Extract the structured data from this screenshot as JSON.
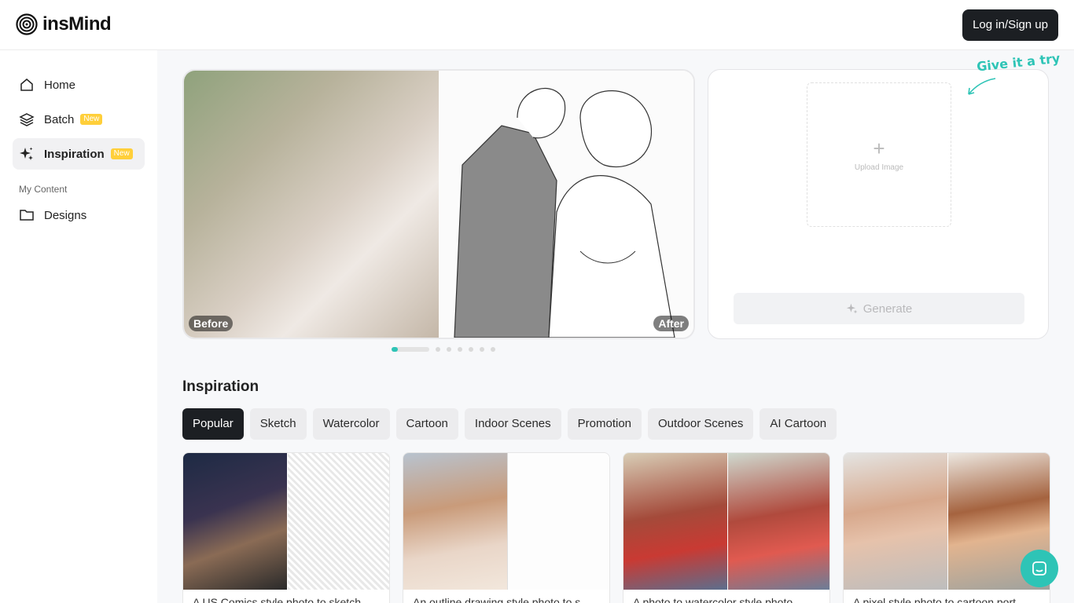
{
  "header": {
    "logo_text": "insMind",
    "login_label": "Log in/Sign up"
  },
  "sidebar": {
    "items": [
      {
        "label": "Home",
        "icon": "home-icon"
      },
      {
        "label": "Batch",
        "icon": "layers-icon",
        "badge": "New"
      },
      {
        "label": "Inspiration",
        "icon": "sparkle-icon",
        "badge": "New",
        "active": true
      }
    ],
    "section_label": "My Content",
    "content_items": [
      {
        "label": "Designs",
        "icon": "folder-icon"
      }
    ]
  },
  "hero": {
    "before_label": "Before",
    "after_label": "After",
    "slides": 7,
    "active_slide": 1
  },
  "upload": {
    "hint": "Give it a try",
    "upload_label": "Upload Image",
    "generate_label": "Generate"
  },
  "inspiration": {
    "title": "Inspiration",
    "tabs": [
      "Popular",
      "Sketch",
      "Watercolor",
      "Cartoon",
      "Indoor Scenes",
      "Promotion",
      "Outdoor Scenes",
      "AI Cartoon"
    ],
    "active_tab": "Popular",
    "cards": [
      {
        "title": "A US Comics style photo to sketch"
      },
      {
        "title": "An outline drawing style photo to s"
      },
      {
        "title": "A photo to watercolor style photo"
      },
      {
        "title": "A pixel style photo to cartoon port"
      }
    ]
  },
  "colors": {
    "accent": "#2ec4b6",
    "dark": "#1c1f23",
    "badge": "#ffcf3a"
  }
}
